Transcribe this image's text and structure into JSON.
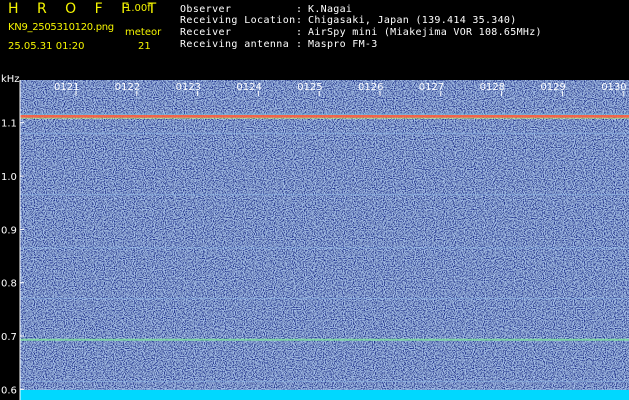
{
  "header": {
    "title": "H R O F F T",
    "version": "1.00f",
    "filename": "KN9_2505310120.png",
    "meteor_label": "meteor",
    "datetime": "25.05.31 01:20",
    "meteor_count": "21",
    "meta": [
      {
        "label": "Observer",
        "value": "K.Nagai"
      },
      {
        "label": "Receiving Location",
        "value": "Chigasaki, Japan (139.414 35.340)"
      },
      {
        "label": "Receiver",
        "value": "AirSpy mini (Miakejima VOR 108.65MHz)"
      },
      {
        "label": "Receiving antenna",
        "value": "Maspro FM-3"
      }
    ]
  },
  "colors": {
    "background": "#1a2f8f",
    "header_text": "#f5f500",
    "axis": "#ffffff",
    "carrier": "#ff6040",
    "baseline": "#00d8ff"
  },
  "chart_data": {
    "type": "heatmap",
    "ylabel": "kHz",
    "ylim": [
      0.58,
      1.18
    ],
    "yticks": [
      0.6,
      0.7,
      0.8,
      0.9,
      1.0,
      1.1
    ],
    "ytick_labels": [
      "0.6",
      "0.7",
      "0.8",
      "0.9",
      "1.0",
      "1.1"
    ],
    "time_markers": [
      "0121",
      "0122",
      "0123",
      "0124",
      "0125",
      "0126",
      "0127",
      "0128",
      "0129",
      "0130"
    ],
    "xlim": [
      0,
      10
    ],
    "signal_lines": [
      {
        "freq": 1.112,
        "kind": "carrier"
      },
      {
        "freq": 1.08,
        "kind": "faint"
      },
      {
        "freq": 0.965,
        "kind": "faint"
      },
      {
        "freq": 0.865,
        "kind": "faint"
      },
      {
        "freq": 0.77,
        "kind": "faint"
      },
      {
        "freq": 0.693,
        "kind": "strong"
      },
      {
        "freq": 0.615,
        "kind": "faint"
      },
      {
        "freq": 0.6,
        "kind": "faint"
      }
    ]
  }
}
